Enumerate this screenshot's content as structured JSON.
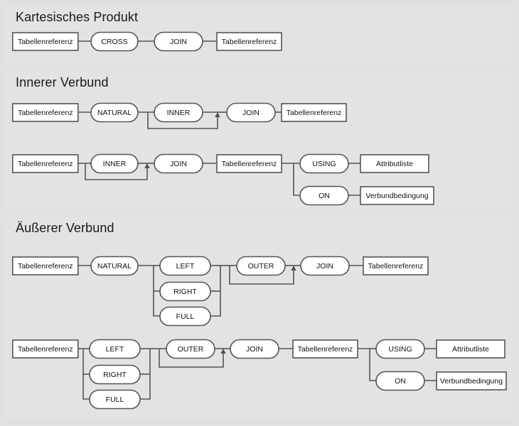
{
  "page": {
    "background_color": "#e0e0e0",
    "panel_color": "#e3e3e3",
    "line_color": "#555555",
    "node_fill": "#ffffff",
    "text_color": "#111111"
  },
  "sections": [
    {
      "id": "cartesian",
      "title": "Kartesisches Produkt",
      "rows": [
        {
          "id": "cartesian-row-1",
          "nodes": [
            "Tabellenreferenz",
            "CROSS",
            "JOIN",
            "Tabellenreferenz"
          ]
        }
      ]
    },
    {
      "id": "inner",
      "title": "Innerer Verbund",
      "rows": [
        {
          "id": "inner-row-1",
          "nodes": [
            "Tabellenreferenz",
            "NATURAL",
            "INNER",
            "JOIN",
            "Tabellenreferenz"
          ],
          "optional": [
            "INNER"
          ]
        },
        {
          "id": "inner-row-2",
          "nodes": [
            "Tabellenreferenz",
            "INNER",
            "JOIN",
            "Tabellenreferenz",
            "USING",
            "Attributliste",
            "ON",
            "Verbundbedingung"
          ],
          "optional": [
            "INNER"
          ],
          "branches": [
            [
              "USING",
              "Attributliste"
            ],
            [
              "ON",
              "Verbundbedingung"
            ]
          ]
        }
      ]
    },
    {
      "id": "outer",
      "title": "Äußerer Verbund",
      "rows": [
        {
          "id": "outer-row-1",
          "nodes": [
            "Tabellenreferenz",
            "NATURAL",
            "LEFT",
            "RIGHT",
            "FULL",
            "OUTER",
            "JOIN",
            "Tabellenreferenz"
          ],
          "alternatives": [
            "LEFT",
            "RIGHT",
            "FULL"
          ],
          "optional": [
            "OUTER"
          ]
        },
        {
          "id": "outer-row-2",
          "nodes": [
            "Tabellenreferenz",
            "LEFT",
            "RIGHT",
            "FULL",
            "OUTER",
            "JOIN",
            "Tabellenreferenz",
            "USING",
            "Attributliste",
            "ON",
            "Verbundbedingung"
          ],
          "alternatives": [
            "LEFT",
            "RIGHT",
            "FULL"
          ],
          "optional": [
            "OUTER"
          ],
          "branches": [
            [
              "USING",
              "Attributliste"
            ],
            [
              "ON",
              "Verbundbedingung"
            ]
          ]
        }
      ]
    }
  ],
  "labels": {
    "tabellenreferenz": "Tabellenreferenz",
    "cross": "CROSS",
    "join": "JOIN",
    "natural": "NATURAL",
    "inner": "INNER",
    "using": "USING",
    "attributliste": "Attributliste",
    "on": "ON",
    "verbundbedingung": "Verbundbedingung",
    "left": "LEFT",
    "right": "RIGHT",
    "full": "FULL",
    "outer": "OUTER"
  }
}
